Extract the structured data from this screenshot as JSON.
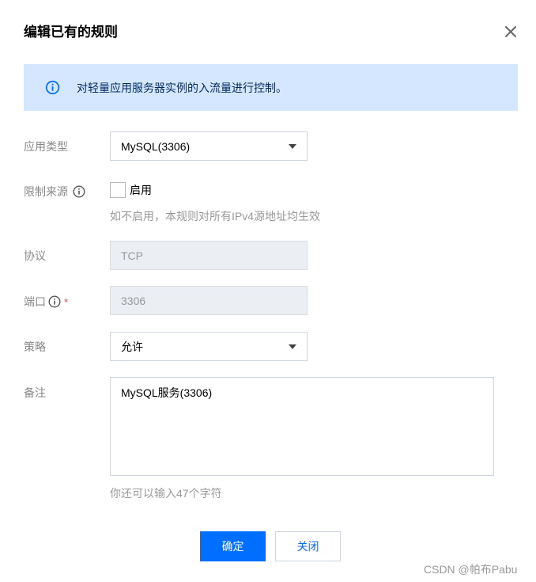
{
  "dialog": {
    "title": "编辑已有的规则",
    "notice": "对轻量应用服务器实例的入流量进行控制。"
  },
  "form": {
    "app_type": {
      "label": "应用类型",
      "value": "MySQL(3306)"
    },
    "limit_source": {
      "label": "限制来源",
      "checkbox_label": "启用",
      "checked": false,
      "hint": "如不启用，本规则对所有IPv4源地址均生效"
    },
    "protocol": {
      "label": "协议",
      "value": "TCP"
    },
    "port": {
      "label": "端口",
      "required_mark": "*",
      "value": "3306"
    },
    "policy": {
      "label": "策略",
      "value": "允许"
    },
    "remark": {
      "label": "备注",
      "value": "MySQL服务(3306)",
      "hint": "你还可以输入47个字符"
    }
  },
  "buttons": {
    "confirm": "确定",
    "close": "关闭"
  },
  "watermark": "CSDN @帕布Pabu",
  "colors": {
    "primary": "#006eff",
    "notice_bg": "#d5e7ff",
    "required": "#e54545"
  }
}
